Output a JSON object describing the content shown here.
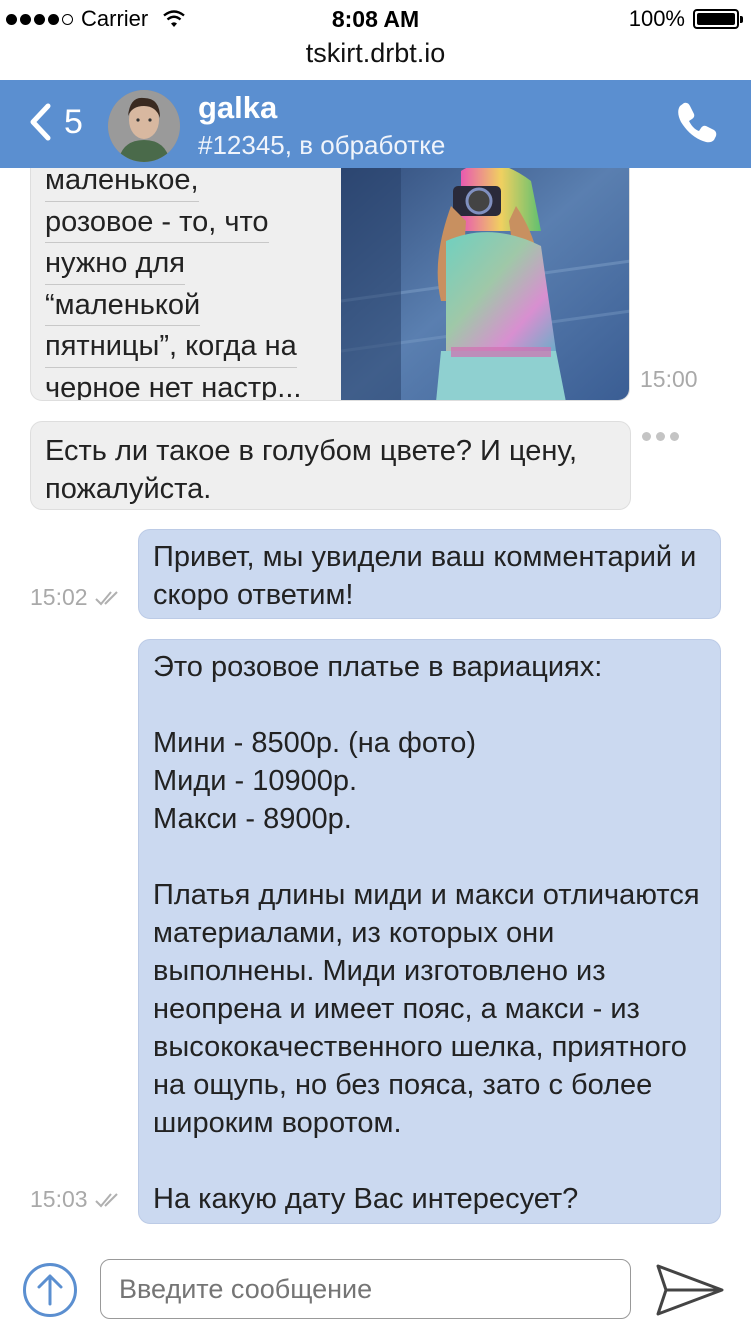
{
  "status_bar": {
    "carrier": "Carrier",
    "time": "8:08 AM",
    "battery": "100%",
    "signal_dots_filled": 4,
    "signal_dots_total": 5
  },
  "browser": {
    "url": "tskirt.drbt.io"
  },
  "header": {
    "back_count": "5",
    "title": "galka",
    "subtitle": "#12345, в обработке",
    "back_icon": "chevron-left-icon",
    "call_icon": "phone-icon",
    "background_color": "#5b8fd0"
  },
  "messages": [
    {
      "direction": "incoming",
      "lines": [
        "маленькое,",
        "розовое - то, что",
        "нужно для",
        "“маленькой",
        "пятницы”, когда на",
        "черное нет настр..."
      ],
      "has_image": true,
      "time": "15:00"
    },
    {
      "direction": "incoming",
      "text": "Есть ли такое в голубом цвете? И цену, пожалуйста."
    },
    {
      "direction": "outgoing",
      "text": "Привет, мы увидели ваш комментарий и скоро ответим!",
      "time": "15:02",
      "read": true
    },
    {
      "direction": "outgoing",
      "text": "Это розовое платье в вариациях:\n\nМини - 8500р. (на фото)\nМиди - 10900р.\nМакси - 8900р.\n\nПлатья длины миди и макси отличаются материалами, из которых они выполнены. Миди изготовлено из неопрена и имеет пояс, а макси - из высококачественного шелка, приятного на ощупь, но без пояса, зато с более широким воротом.\n\nНа какую дату Вас интересует?",
      "time": "15:03",
      "read": true
    }
  ],
  "composer": {
    "placeholder": "Введите сообщение",
    "upload_icon": "upload-arrow-icon",
    "send_icon": "send-icon"
  },
  "colors": {
    "accent": "#5b8fd0",
    "incoming_bubble": "#efefef",
    "outgoing_bubble": "#cbd9f0"
  }
}
